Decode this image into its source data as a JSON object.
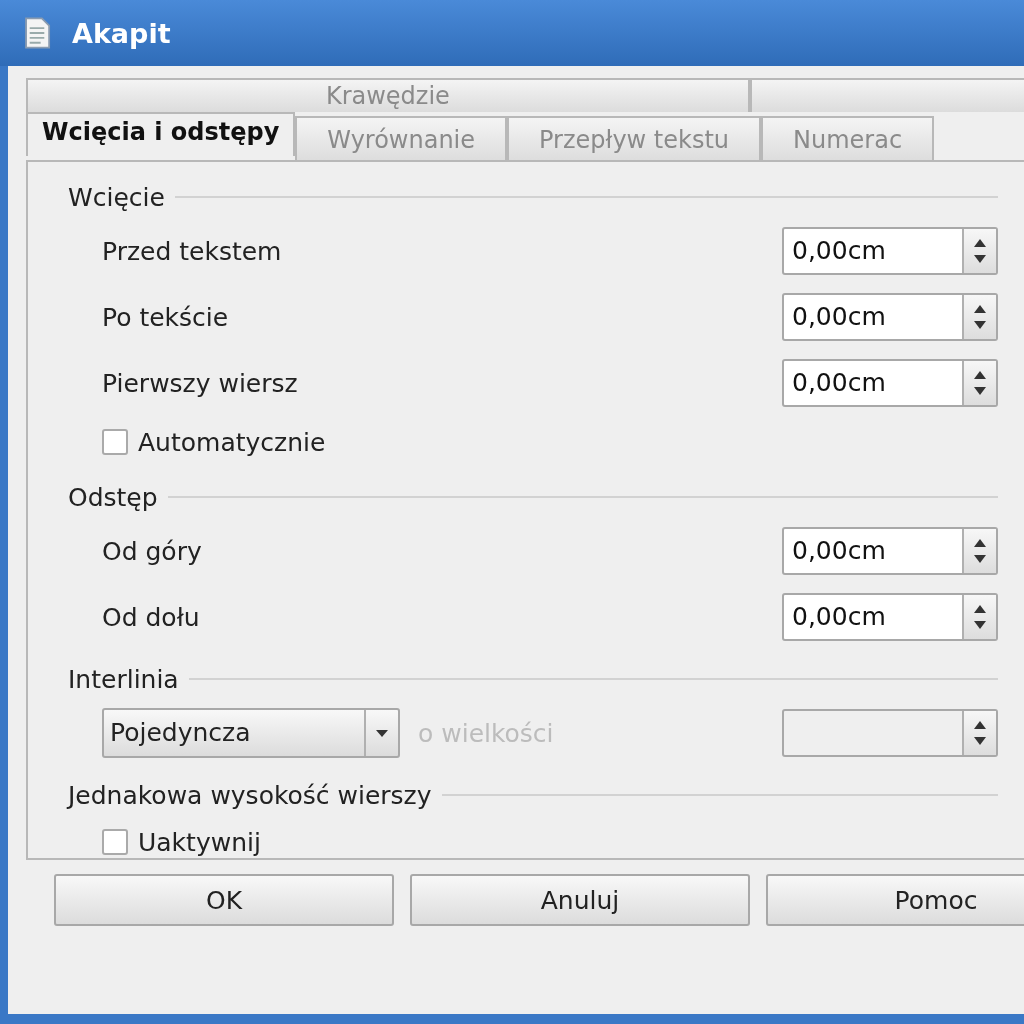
{
  "window": {
    "title": "Akapit"
  },
  "tab_rows": [
    {
      "tabs": [
        {
          "label": "Krawędzie",
          "selected": false
        },
        {
          "selected": false
        }
      ]
    },
    {
      "tabs": [
        {
          "label": "Wcięcia i odstępy",
          "selected": true
        },
        {
          "label": "Wyrównanie",
          "selected": false
        },
        {
          "label": "Przepływ tekstu",
          "selected": false
        },
        {
          "label": "Numerac",
          "selected": false
        }
      ]
    }
  ],
  "sections": [
    {
      "title": "Wcięcie",
      "rows": [
        {
          "kind": "spin",
          "label": "Przed tekstem",
          "value": "0,00cm"
        },
        {
          "kind": "spin",
          "label": "Po tekście",
          "value": "0,00cm"
        },
        {
          "kind": "spin",
          "label": "Pierwszy wiersz",
          "value": "0,00cm"
        },
        {
          "kind": "checkbox",
          "label": "Automatycznie",
          "checked": false
        }
      ]
    },
    {
      "title": "Odstęp",
      "rows": [
        {
          "kind": "spin",
          "label": "Od góry",
          "value": "0,00cm"
        },
        {
          "kind": "spin",
          "label": "Od dołu",
          "value": "0,00cm"
        }
      ]
    },
    {
      "title": "Interlinia",
      "rows": [
        {
          "kind": "dropdown",
          "value": "Pojedyncza",
          "label": "o wielkości",
          "disabled": true
        }
      ]
    },
    {
      "title": "Jednakowa wysokość wierszy",
      "rows": [
        {
          "kind": "checkbox",
          "label": "Uaktywnij",
          "checked": false
        }
      ]
    }
  ],
  "buttons": [
    "OK",
    "Anuluj",
    "Pomoc"
  ]
}
